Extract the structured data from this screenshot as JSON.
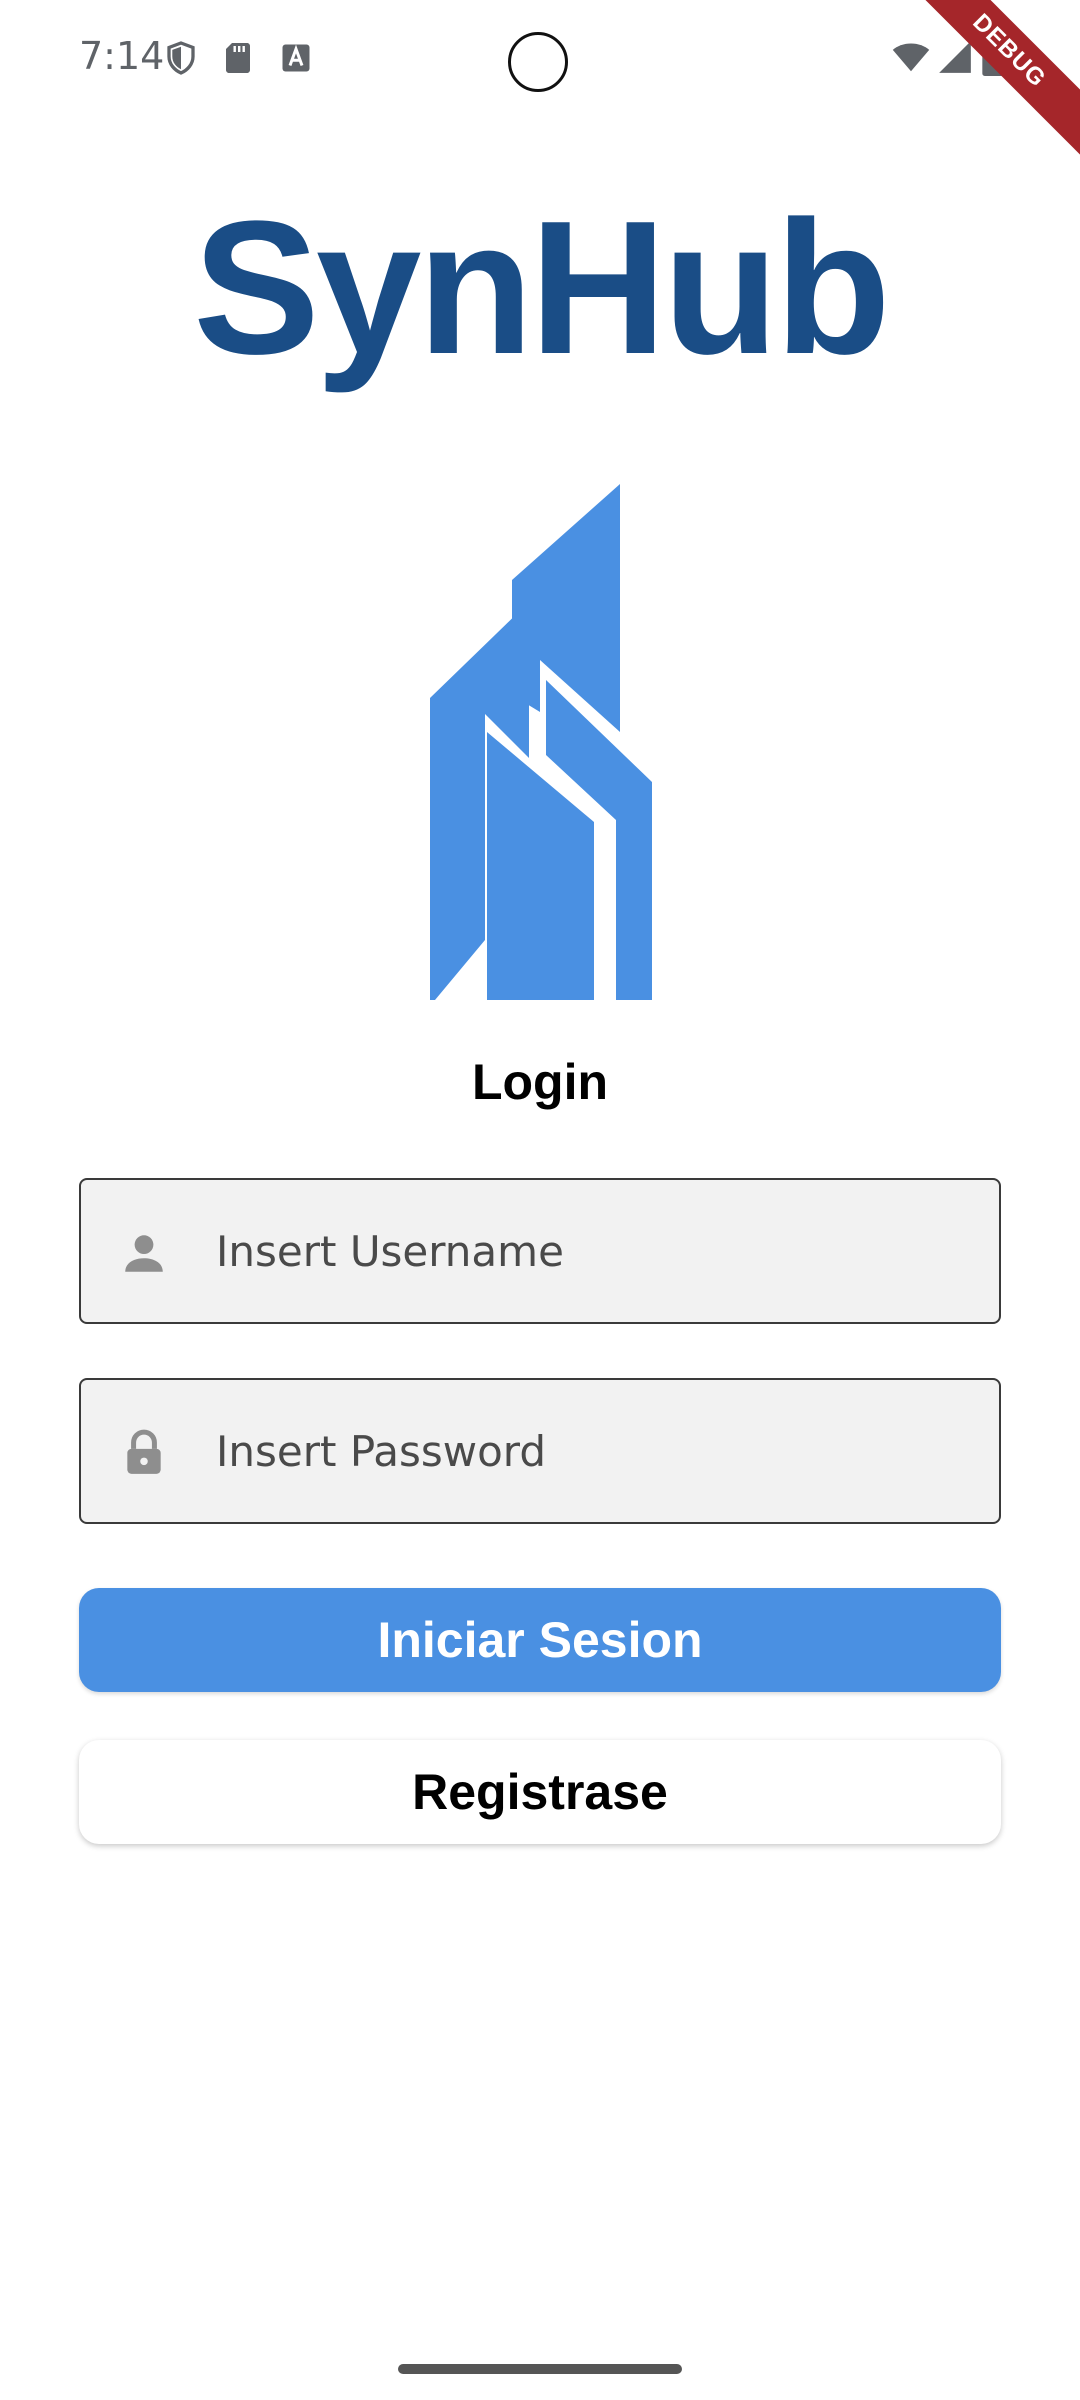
{
  "status_bar": {
    "time": "7:14",
    "debug_label": "DEBUG",
    "icons": [
      "shield-icon",
      "sd-card-icon",
      "text-a-icon",
      "wifi-icon",
      "signal-icon",
      "battery-icon"
    ]
  },
  "app": {
    "title": "SynHub",
    "brand_color": "#1a4d86",
    "logo_color": "#4a90e2",
    "logo_icon": "building-logo-icon"
  },
  "login": {
    "heading": "Login",
    "username": {
      "placeholder": "Insert Username",
      "value": "",
      "icon": "person-icon"
    },
    "password": {
      "placeholder": "Insert Password",
      "value": "",
      "icon": "lock-icon"
    },
    "submit_label": "Iniciar Sesion",
    "register_label": "Registrase"
  },
  "colors": {
    "primary": "#4a90e2",
    "field_bg": "#f2f2f2",
    "icon_gray": "#8e8e8e",
    "debug_banner": "#a5262a"
  }
}
